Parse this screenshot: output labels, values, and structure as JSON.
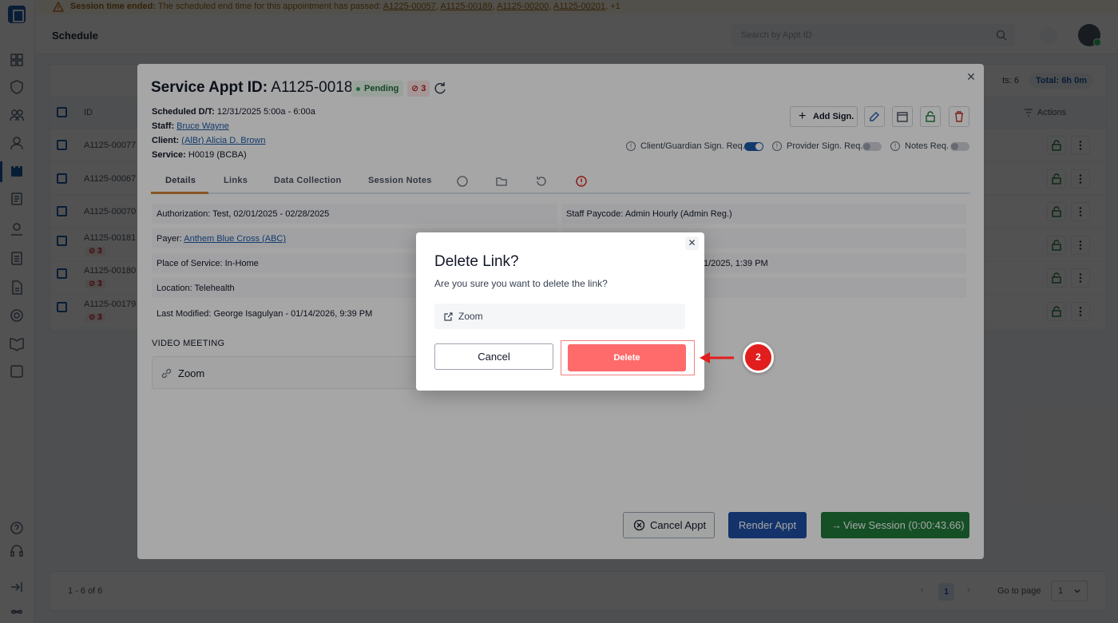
{
  "alert": {
    "title": "Session time ended:",
    "message": "The scheduled end time for this appointment has passed:",
    "ids": [
      "A1225-00057",
      "A1125-00189",
      "A1125-00200",
      "A1125-00201"
    ],
    "more": "+1"
  },
  "topbar": {
    "title": "Schedule",
    "search_placeholder": "Search by Appt ID"
  },
  "table": {
    "stats_count_label": "ts: 6",
    "stats_total": "Total: 6h 0m",
    "col_id": "ID",
    "col_actions": "Actions",
    "rows": [
      {
        "id": "A1125-00077",
        "badge": ""
      },
      {
        "id": "A1125-00067",
        "badge": ""
      },
      {
        "id": "A1125-00070",
        "badge": ""
      },
      {
        "id": "A1125-00181",
        "badge": "3"
      },
      {
        "id": "A1125-00180",
        "badge": "3"
      },
      {
        "id": "A1125-00179",
        "badge": "3"
      }
    ]
  },
  "pager": {
    "range": "1 - 6 of 6",
    "current_page": "1",
    "goto_label": "Go to page",
    "goto_value": "1",
    "prev": "‹",
    "next": "›"
  },
  "appt": {
    "title_label": "Service Appt ID:",
    "title_id": "A1125-00181",
    "status": "Pending",
    "error_count": "3",
    "scheduled_label": "Scheduled D/T:",
    "scheduled_value": "12/31/2025  5:00a - 6:00a",
    "staff_label": "Staff:",
    "staff_value": "Bruce Wayne",
    "client_label": "Client:",
    "client_value": "(AlBr) Alicia D. Brown",
    "service_label": "Service:",
    "service_value": "H0019 (BCBA)",
    "add_sign": "Add Sign.",
    "client_sign_req": "Client/Guardian Sign. Req.",
    "provider_sign_req": "Provider Sign. Req.",
    "notes_req": "Notes Req.",
    "tabs": [
      "Details",
      "Links",
      "Data Collection",
      "Session Notes"
    ],
    "details": {
      "authorization_label": "Authorization:",
      "authorization_value": "Test, 02/01/2025 - 02/28/2025",
      "payer_label": "Payer:",
      "payer_value": "Anthem Blue Cross (ABC)",
      "pos_label": "Place of Service:",
      "pos_value": "In-Home",
      "location_label": "Location:",
      "location_value": "Telehealth",
      "modified_label": "Last Modified:",
      "modified_value": "George Isagulyan - 01/14/2026, 9:39 PM",
      "paycode_label": "Staff Paycode:",
      "paycode_value": "Admin Hourly (Admin Reg.)",
      "right_row3_partial": "1/2025, 1:39 PM"
    },
    "video_label": "VIDEO MEETING",
    "video_link": "Zoom",
    "cancel_appt": "Cancel Appt",
    "render_appt": "Render Appt",
    "view_session": "View Session  (0:00:43.66)"
  },
  "dialog": {
    "title": "Delete Link?",
    "message": "Are you sure you want to delete the link?",
    "link_name": "Zoom",
    "cancel": "Cancel",
    "delete": "Delete"
  },
  "annotation": {
    "step": "2"
  },
  "colors": {
    "primary": "#1e5aa8",
    "danger": "#ff6b6b",
    "success": "#1f7a3a",
    "annotation": "#e11d1d"
  }
}
